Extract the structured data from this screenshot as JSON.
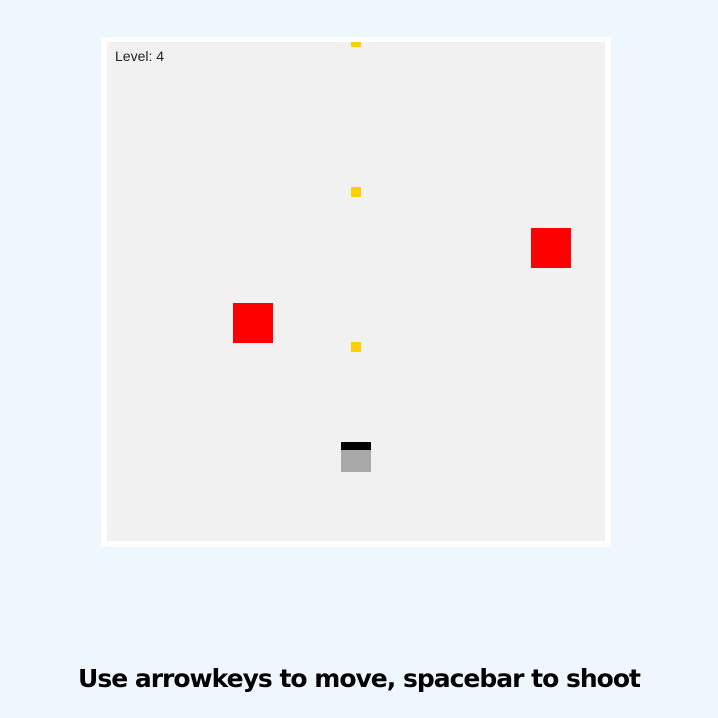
{
  "game": {
    "level_label": "Level: 4",
    "colors": {
      "page_background": "#eff7fe",
      "frame_border": "#ffffff",
      "canvas_background": "#f1f1f1",
      "enemy": "#ff0000",
      "bullet": "#ffd000",
      "player_cannon": "#000000",
      "player_body": "#a9a9a9"
    }
  },
  "instructions": {
    "text": "Use arrowkeys to move, spacebar to shoot"
  }
}
